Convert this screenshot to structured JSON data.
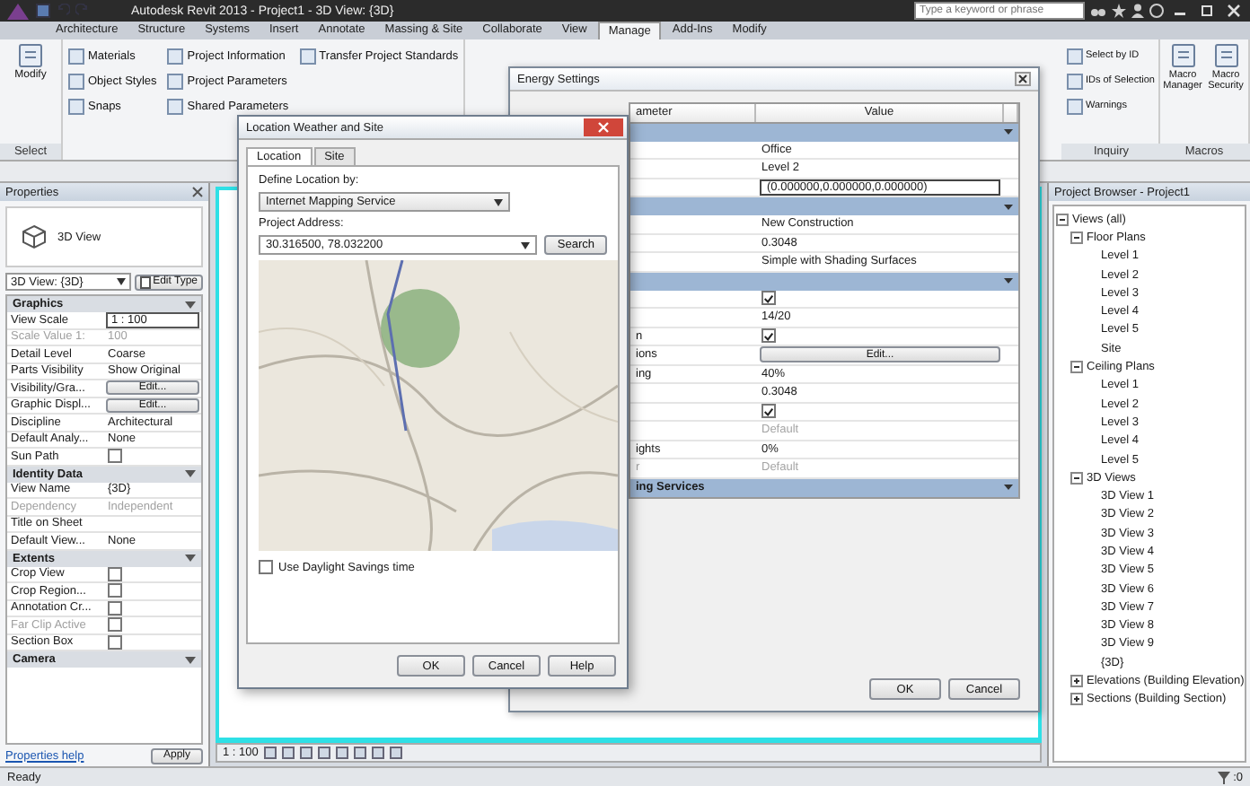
{
  "app": {
    "title": "Autodesk Revit 2013 - Project1 - 3D View: {3D}",
    "search_placeholder": "Type a keyword or phrase"
  },
  "ribbon": {
    "tabs": [
      {
        "label": "Architecture",
        "selected": false
      },
      {
        "label": "Structure",
        "selected": false
      },
      {
        "label": "Systems",
        "selected": false
      },
      {
        "label": "Insert",
        "selected": false
      },
      {
        "label": "Annotate",
        "selected": false
      },
      {
        "label": "Massing & Site",
        "selected": false
      },
      {
        "label": "Collaborate",
        "selected": false
      },
      {
        "label": "View",
        "selected": false
      },
      {
        "label": "Manage",
        "selected": true
      },
      {
        "label": "Add-Ins",
        "selected": false
      },
      {
        "label": "Modify",
        "selected": false
      }
    ],
    "left_panels": [
      {
        "label": "Select",
        "kind": "large",
        "items": [
          "Modify"
        ]
      },
      {
        "kind": "small",
        "items": [
          "Materials",
          "Object Styles",
          "Snaps",
          "Project Information",
          "Project Parameters",
          "Shared Parameters",
          "Transfer Project Standards"
        ]
      }
    ],
    "right_panels": [
      {
        "label": "Inquiry",
        "kind": "small",
        "items": [
          "Select by ID",
          "IDs of Selection",
          "Warnings"
        ]
      },
      {
        "label": "Macros",
        "kind": "large",
        "items": [
          "Macro Manager",
          "Macro Security"
        ]
      }
    ]
  },
  "properties": {
    "title": "Properties",
    "type_name": "3D View",
    "instance": "3D View: {3D}",
    "edit_type": "Edit Type",
    "groups": [
      {
        "title": "Graphics",
        "rows": [
          {
            "name": "View Scale",
            "value": "1 : 100",
            "kind": "field",
            "disabled": false
          },
          {
            "name": "Scale Value 1:",
            "value": "100",
            "kind": "text",
            "disabled": true
          },
          {
            "name": "Detail Level",
            "value": "Coarse",
            "kind": "text",
            "disabled": false
          },
          {
            "name": "Parts Visibility",
            "value": "Show Original",
            "kind": "text",
            "disabled": false
          },
          {
            "name": "Visibility/Gra...",
            "value": "Edit...",
            "kind": "button",
            "disabled": false
          },
          {
            "name": "Graphic Displ...",
            "value": "Edit...",
            "kind": "button",
            "disabled": false
          },
          {
            "name": "Discipline",
            "value": "Architectural",
            "kind": "text",
            "disabled": false
          },
          {
            "name": "Default Analy...",
            "value": "None",
            "kind": "text",
            "disabled": false
          },
          {
            "name": "Sun Path",
            "checked": false,
            "kind": "check",
            "disabled": false
          }
        ]
      },
      {
        "title": "Identity Data",
        "rows": [
          {
            "name": "View Name",
            "value": "{3D}",
            "kind": "text",
            "disabled": false
          },
          {
            "name": "Dependency",
            "value": "Independent",
            "kind": "text",
            "disabled": true
          },
          {
            "name": "Title on Sheet",
            "value": "",
            "kind": "text",
            "disabled": false
          },
          {
            "name": "Default View...",
            "value": "None",
            "kind": "text",
            "disabled": false
          }
        ]
      },
      {
        "title": "Extents",
        "rows": [
          {
            "name": "Crop View",
            "checked": false,
            "kind": "check",
            "disabled": false
          },
          {
            "name": "Crop Region...",
            "checked": false,
            "kind": "check",
            "disabled": false
          },
          {
            "name": "Annotation Cr...",
            "checked": false,
            "kind": "check",
            "disabled": false
          },
          {
            "name": "Far Clip Active",
            "checked": false,
            "kind": "check",
            "disabled": true
          },
          {
            "name": "Section Box",
            "checked": false,
            "kind": "check",
            "disabled": false
          }
        ]
      },
      {
        "title": "Camera"
      }
    ],
    "help_link": "Properties help",
    "apply": "Apply"
  },
  "view": {
    "scale": "1 : 100"
  },
  "project_browser": {
    "title": "Project Browser - Project1",
    "tree": [
      {
        "label": "Views (all)",
        "expanded": true,
        "children": [
          {
            "label": "Floor Plans",
            "expanded": true,
            "children": [
              {
                "label": "Level 1"
              },
              {
                "label": "Level 2"
              },
              {
                "label": "Level 3"
              },
              {
                "label": "Level 4"
              },
              {
                "label": "Level 5"
              },
              {
                "label": "Site"
              }
            ]
          },
          {
            "label": "Ceiling Plans",
            "expanded": true,
            "children": [
              {
                "label": "Level 1"
              },
              {
                "label": "Level 2"
              },
              {
                "label": "Level 3"
              },
              {
                "label": "Level 4"
              },
              {
                "label": "Level 5"
              }
            ]
          },
          {
            "label": "3D Views",
            "expanded": true,
            "children": [
              {
                "label": "3D View 1"
              },
              {
                "label": "3D View 2"
              },
              {
                "label": "3D View 3"
              },
              {
                "label": "3D View 4"
              },
              {
                "label": "3D View 5"
              },
              {
                "label": "3D View 6"
              },
              {
                "label": "3D View 7"
              },
              {
                "label": "3D View 8"
              },
              {
                "label": "3D View 9"
              },
              {
                "label": "{3D}"
              }
            ]
          },
          {
            "label": "Elevations (Building Elevation)",
            "expanded": false
          },
          {
            "label": "Sections (Building Section)",
            "expanded": false
          }
        ]
      }
    ]
  },
  "status_bar": {
    "text": "Ready",
    "filter_count": ":0"
  },
  "energy_dialog": {
    "title": "Energy Settings",
    "columns": [
      "ameter",
      "Value"
    ],
    "groups": [
      {
        "rows": [
          {
            "param": "",
            "value": "Office",
            "kind": "text",
            "disabled": false
          },
          {
            "param": "",
            "value": "Level 2",
            "kind": "text",
            "disabled": false
          },
          {
            "param": "",
            "value": "(0.000000,0.000000,0.000000)",
            "kind": "field",
            "disabled": false
          }
        ]
      },
      {
        "rows": [
          {
            "param": "",
            "value": "New Construction",
            "kind": "text",
            "disabled": false
          },
          {
            "param": "",
            "value": "0.3048",
            "kind": "text",
            "disabled": false
          },
          {
            "param": "",
            "value": "Simple with Shading Surfaces",
            "kind": "text",
            "disabled": false
          }
        ]
      },
      {
        "rows": [
          {
            "param": "",
            "checked": true,
            "kind": "check",
            "disabled": false
          },
          {
            "param": "",
            "value": "14/20",
            "kind": "text",
            "disabled": false
          },
          {
            "param": "n",
            "checked": true,
            "kind": "check",
            "disabled": false
          },
          {
            "param": "ions",
            "value": "Edit...",
            "kind": "button",
            "disabled": false
          },
          {
            "param": "ing",
            "value": "40%",
            "kind": "text",
            "disabled": false
          },
          {
            "param": "",
            "value": "0.3048",
            "kind": "text",
            "disabled": false
          },
          {
            "param": "",
            "checked": true,
            "kind": "check",
            "disabled": false
          },
          {
            "param": "",
            "value": "Default",
            "kind": "text",
            "disabled": true
          },
          {
            "param": "ights",
            "value": "0%",
            "kind": "text",
            "disabled": false
          },
          {
            "param": "r",
            "value": "Default",
            "kind": "text",
            "disabled": true
          }
        ]
      },
      {
        "title": "ing Services"
      }
    ],
    "buttons": [
      "OK",
      "Cancel"
    ]
  },
  "location_dialog": {
    "title": "Location Weather and Site",
    "tabs": [
      {
        "label": "Location",
        "selected": true
      },
      {
        "label": "Site",
        "selected": false
      }
    ],
    "define_label": "Define Location by:",
    "define_value": "Internet Mapping Service",
    "address_label": "Project Address:",
    "address_value": "30.316500, 78.032200",
    "search": "Search",
    "daylight_label": "Use Daylight Savings time",
    "daylight_checked": false,
    "buttons": [
      "OK",
      "Cancel",
      "Help"
    ]
  }
}
